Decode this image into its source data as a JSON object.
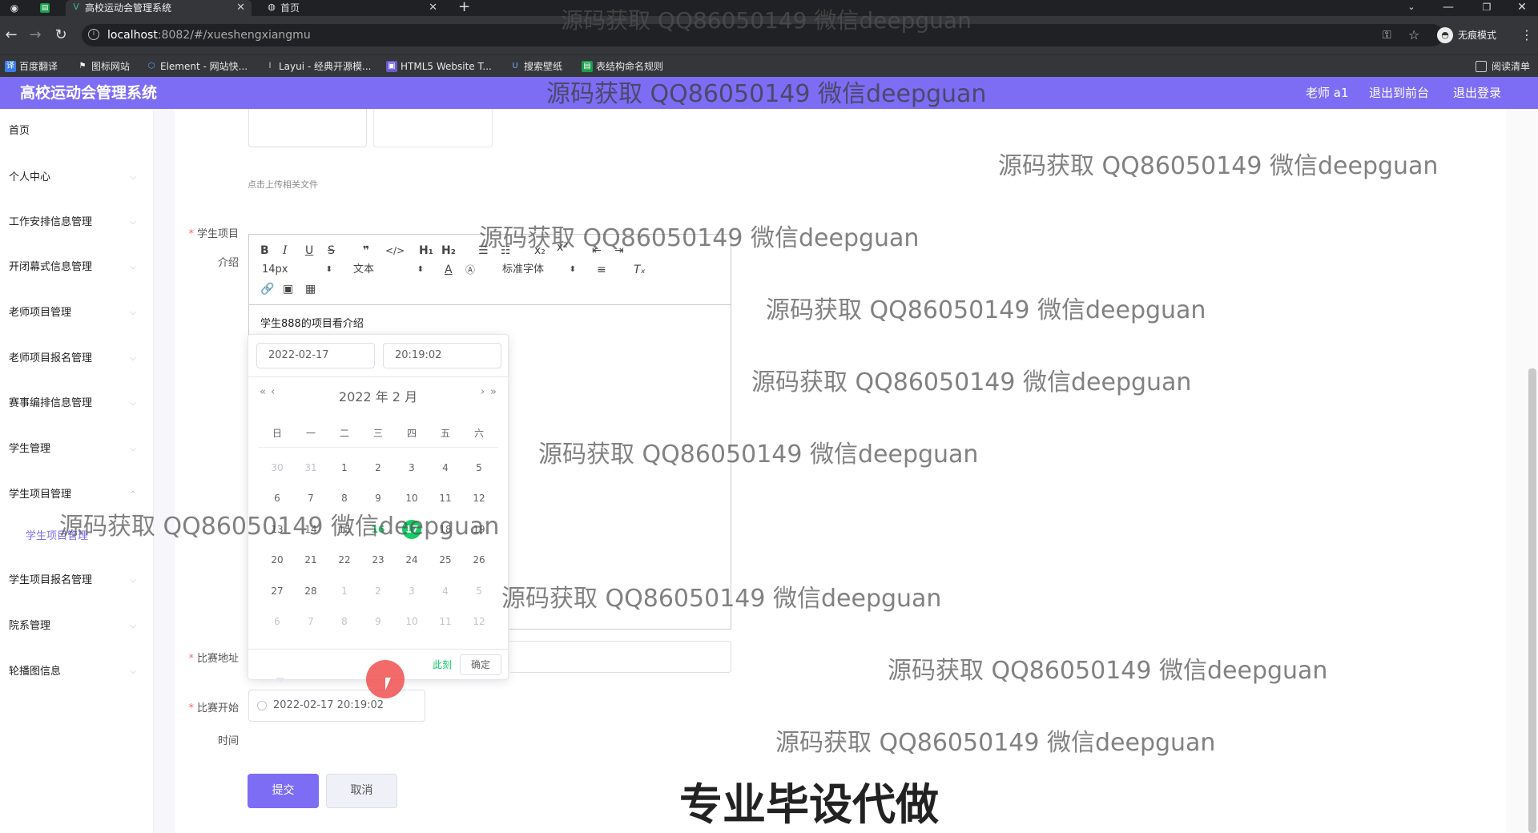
{
  "browser": {
    "tabs": [
      {
        "label": "高校运动会管理系统",
        "active": true
      },
      {
        "label": "首页",
        "active": false
      }
    ],
    "url_host": "localhost",
    "url_path": ":8082/#/xueshengxiangmu",
    "incognito_label": "无痕模式",
    "bookmarks": [
      "百度翻译",
      "图标网站",
      "Element - 网站快...",
      "Layui - 经典开源模...",
      "HTML5 Website T...",
      "搜索壁纸",
      "表结构命名规则"
    ],
    "reading_list": "阅读清单"
  },
  "header": {
    "title": "高校运动会管理系统",
    "user": "老师 a1",
    "front_link": "退出到前台",
    "logout_link": "退出登录"
  },
  "sidebar": {
    "items": [
      {
        "label": "首页"
      },
      {
        "label": "个人中心"
      },
      {
        "label": "工作安排信息管理"
      },
      {
        "label": "开闭幕式信息管理"
      },
      {
        "label": "老师项目管理"
      },
      {
        "label": "老师项目报名管理"
      },
      {
        "label": "赛事编排信息管理"
      },
      {
        "label": "学生管理"
      },
      {
        "label": "学生项目管理"
      },
      {
        "label": "学生项目报名管理"
      },
      {
        "label": "院系管理"
      },
      {
        "label": "轮播图信息"
      }
    ],
    "active_sub": "学生项目管理"
  },
  "form": {
    "upload_tip": "点击上传相关文件",
    "intro_label_1": "学生项目",
    "intro_label_2": "介绍",
    "editor_font_size": "14px",
    "editor_format": "文本",
    "editor_font": "标准字体",
    "editor_content": "学生888的项目看介绍",
    "address_label": "比赛地址",
    "start_label_1": "比赛开始",
    "start_label_2": "时间",
    "start_value": "2022-02-17 20:19:02",
    "submit_label": "提交",
    "cancel_label": "取消"
  },
  "picker": {
    "date_value": "2022-02-17",
    "time_value": "20:19:02",
    "title": "2022 年  2 月",
    "weekdays": [
      "日",
      "一",
      "二",
      "三",
      "四",
      "五",
      "六"
    ],
    "rows": [
      [
        "30",
        "31",
        "1",
        "2",
        "3",
        "4",
        "5"
      ],
      [
        "6",
        "7",
        "8",
        "9",
        "10",
        "11",
        "12"
      ],
      [
        "13",
        "14",
        "15",
        "16",
        "17",
        "18",
        "19"
      ],
      [
        "20",
        "21",
        "22",
        "23",
        "24",
        "25",
        "26"
      ],
      [
        "27",
        "28",
        "1",
        "2",
        "3",
        "4",
        "5"
      ],
      [
        "6",
        "7",
        "8",
        "9",
        "10",
        "11",
        "12"
      ]
    ],
    "now_label": "此刻",
    "ok_label": "确定"
  },
  "watermarks": {
    "text": "源码获取 QQ86050149 微信deepguan",
    "banner": "专业毕设代做"
  },
  "colors": {
    "accent": "#7d6df4",
    "selected_day": "#13ce66",
    "required": "#f56c6c"
  }
}
